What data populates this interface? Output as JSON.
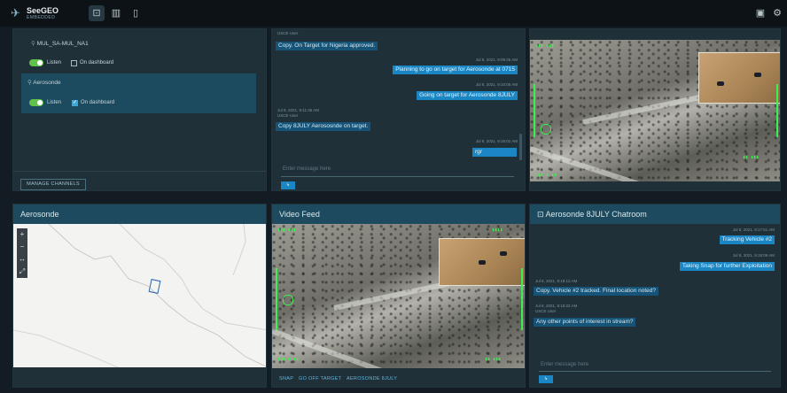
{
  "app": {
    "brand": "SeeGEO",
    "brand_sub": "EMBEDDED"
  },
  "topbar": {
    "nav_icons": [
      "chart-icon",
      "library-icon",
      "document-icon"
    ],
    "right_icons": [
      "archive-icon",
      "settings-icon"
    ]
  },
  "channels": {
    "items": [
      {
        "name": "MUL_SA-MUL_NA1",
        "listen_label": "Listen",
        "listen_on": true,
        "dashboard_label": "On dashboard",
        "dashboard_on": false
      },
      {
        "name": "Aerosonde",
        "listen_label": "Listen",
        "listen_on": true,
        "dashboard_label": "On dashboard",
        "dashboard_on": true
      }
    ],
    "manage_label": "MANAGE CHANNELS"
  },
  "chat_top": {
    "messages": [
      {
        "meta": "USCE User",
        "text": "Copy. On Target for Nigeria approved.",
        "dir": "in"
      },
      {
        "meta": "Jul 8, 2021, 9:09:46 AM",
        "text": "Planning to go on target for Aerosonde at 0715",
        "dir": "out"
      },
      {
        "meta": "Jul 8, 2021, 9:10:06 AM",
        "text": "Going on target for Aerosonde 8JULY",
        "dir": "out"
      },
      {
        "meta": "Jul 8, 2021, 9:11:36 AM",
        "meta2": "USCE User",
        "text": "Copy 8JULY Aerososnde on target.",
        "dir": "in"
      },
      {
        "meta": "Jul 8, 2021, 9:16:02 AM",
        "text": "rgr",
        "dir": "out"
      }
    ],
    "input_placeholder": "Enter message here",
    "send_icon": "send-icon"
  },
  "map_panel": {
    "title": "Aerosonde",
    "controls": [
      "+",
      "−",
      "↔",
      "⤢"
    ]
  },
  "video_panel": {
    "title": "Video Feed",
    "actions": [
      "SNAP",
      "GO OFF TARGET",
      "AEROSONDE 8JULY"
    ]
  },
  "chat_bottom": {
    "title": "Aerosonde 8JULY Chatroom",
    "messages": [
      {
        "meta": "Jul 8, 2021, 9:17:51 AM",
        "text": "Tracking Vehicle #2",
        "dir": "out"
      },
      {
        "meta": "Jul 8, 2021, 9:18:09 AM",
        "text": "Taking Snap for further Exploitation",
        "dir": "out"
      },
      {
        "meta": "Jul 8, 2021, 9:18:12 AM",
        "text": "Copy. Vehicle #2 tracked. Final location noted?",
        "dir": "in"
      },
      {
        "meta": "Jul 8, 2021, 9:18:22 AM",
        "meta2": "USCE User",
        "text": "Any other points of interest in stream?",
        "dir": "in"
      }
    ],
    "input_placeholder": "Enter message here"
  },
  "colors": {
    "accent": "#1a86c4",
    "header": "#1d4a5e",
    "panel": "#1f3039",
    "toggle_on": "#61c24a",
    "hud": "#3cf04f"
  }
}
